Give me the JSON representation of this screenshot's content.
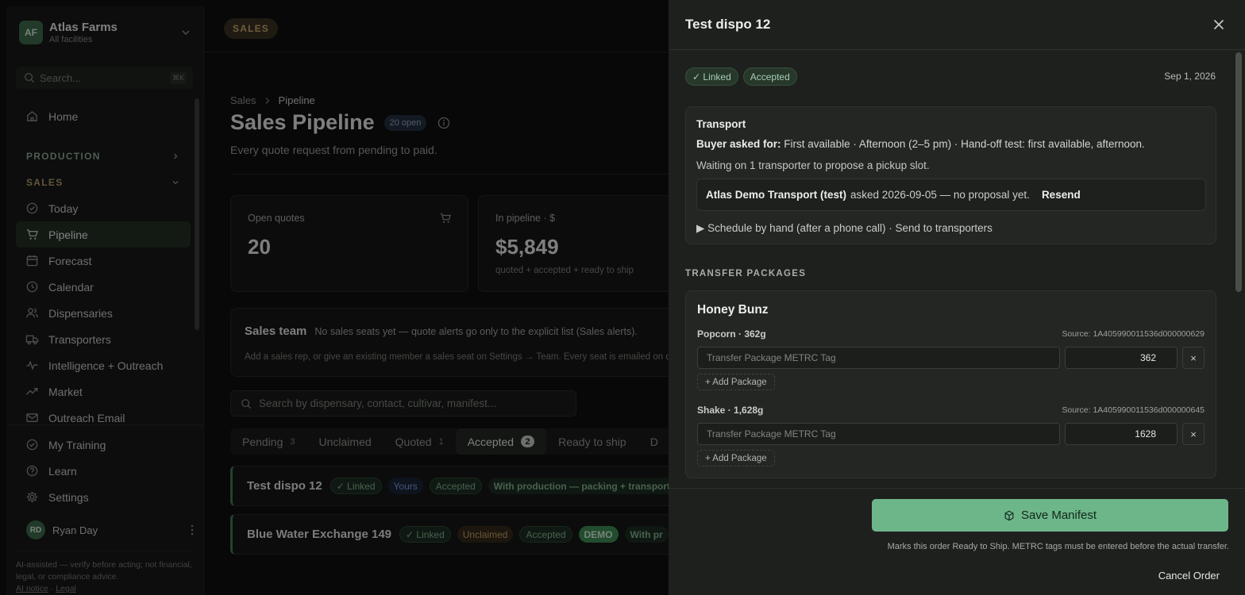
{
  "org": {
    "initials": "AF",
    "name": "Atlas Farms",
    "subtitle": "All facilities"
  },
  "search": {
    "placeholder": "Search...",
    "shortcut": "⌘K"
  },
  "nav": {
    "home": "Home",
    "production_section": "PRODUCTION",
    "sales_section": "SALES",
    "sales_items": [
      {
        "label": "Today",
        "icon": "check-circle-icon"
      },
      {
        "label": "Pipeline",
        "icon": "cart-icon",
        "active": true
      },
      {
        "label": "Forecast",
        "icon": "calendar-grid-icon"
      },
      {
        "label": "Calendar",
        "icon": "clock-icon"
      },
      {
        "label": "Dispensaries",
        "icon": "users-icon"
      },
      {
        "label": "Transporters",
        "icon": "truck-icon"
      },
      {
        "label": "Intelligence + Outreach",
        "icon": "pulse-icon"
      },
      {
        "label": "Market",
        "icon": "trend-up-icon"
      },
      {
        "label": "Outreach Email",
        "icon": "mail-icon"
      }
    ],
    "bottom_items": [
      {
        "label": "My Training",
        "icon": "check-circle-icon"
      },
      {
        "label": "Learn",
        "icon": "help-circle-icon"
      },
      {
        "label": "Settings",
        "icon": "gear-icon"
      }
    ]
  },
  "user": {
    "initials": "RD",
    "name": "Ryan Day"
  },
  "disclaimer": {
    "text": "AI-assisted — verify before acting; not financial, legal, or compliance advice.",
    "ai_notice": "AI notice",
    "sep": " · ",
    "legal": "Legal"
  },
  "topbar": {
    "pill": "SALES"
  },
  "page": {
    "breadcrumb_root": "Sales",
    "breadcrumb_current": "Pipeline",
    "title": "Sales Pipeline",
    "open_count": "20 open",
    "subtitle": "Every quote request from pending to paid."
  },
  "cards": [
    {
      "label": "Open quotes",
      "value": "20",
      "caption": ""
    },
    {
      "label": "In pipeline · $",
      "value": "$5,849",
      "caption": "quoted + accepted + ready to ship"
    }
  ],
  "team": {
    "title": "Sales team",
    "note": "No sales seats yet — quote alerts go only to the explicit list (Sales alerts).",
    "help": "Add a sales rep, or give an existing member a sales seat on Settings → Team. Every seat is emailed on quote"
  },
  "quote_search": {
    "placeholder": "Search by dispensary, contact, cultivar, manifest..."
  },
  "tabs": [
    {
      "label": "Pending",
      "count": "3"
    },
    {
      "label": "Unclaimed",
      "count": ""
    },
    {
      "label": "Quoted",
      "count": "1"
    },
    {
      "label": "Accepted",
      "count": "2",
      "active": true
    },
    {
      "label": "Ready to ship",
      "count": ""
    },
    {
      "label": "D",
      "count": ""
    }
  ],
  "rows": [
    {
      "title": "Test dispo 12",
      "tags": [
        {
          "text": "✓ Linked",
          "style": "green"
        },
        {
          "text": "Yours",
          "style": "blue"
        },
        {
          "text": "Accepted",
          "style": "green"
        },
        {
          "text": "With production — packing + transport",
          "style": "wide"
        }
      ]
    },
    {
      "title": "Blue Water Exchange 149",
      "tags": [
        {
          "text": "✓ Linked",
          "style": "green"
        },
        {
          "text": "Unclaimed",
          "style": "amber"
        },
        {
          "text": "Accepted",
          "style": "green"
        },
        {
          "text": "DEMO",
          "style": "demo"
        },
        {
          "text": "With pr",
          "style": "wide"
        }
      ]
    }
  ],
  "drawer": {
    "title": "Test dispo 12",
    "status_tags": [
      "✓ Linked",
      "Accepted"
    ],
    "date": "Sep 1, 2026",
    "transport": {
      "heading": "Transport",
      "buyer_label": "Buyer asked for:",
      "buyer_text": " First available · Afternoon (2–5 pm) · Hand-off test: first available, afternoon.",
      "waiting": "Waiting on 1 transporter to propose a pickup slot.",
      "transporter": "Atlas Demo Transport (test)",
      "asked": "asked 2026-09-05 — no proposal yet.",
      "resend": "Resend",
      "schedule": "▶ Schedule by hand (after a phone call) · Send to transporters"
    },
    "section_title": "TRANSFER PACKAGES",
    "product": "Honey Bunz",
    "packages": [
      {
        "label": "Popcorn · 362g",
        "source": "Source: 1A405990011536d000000629",
        "tag_placeholder": "Transfer Package METRC Tag",
        "qty": "362",
        "remove": "×",
        "add": "+ Add Package"
      },
      {
        "label": "Shake · 1,628g",
        "source": "Source: 1A405990011536d000000645",
        "tag_placeholder": "Transfer Package METRC Tag",
        "qty": "1628",
        "remove": "×",
        "add": "+ Add Package"
      }
    ],
    "save_label": "Save Manifest",
    "save_note": "Marks this order Ready to Ship. METRC tags must be entered before the actual transfer.",
    "cancel_label": "Cancel Order"
  },
  "colors": {
    "accent": "#6db68a",
    "sales_pill": "#c9a96e",
    "drawer_bg": "#1e201e"
  }
}
